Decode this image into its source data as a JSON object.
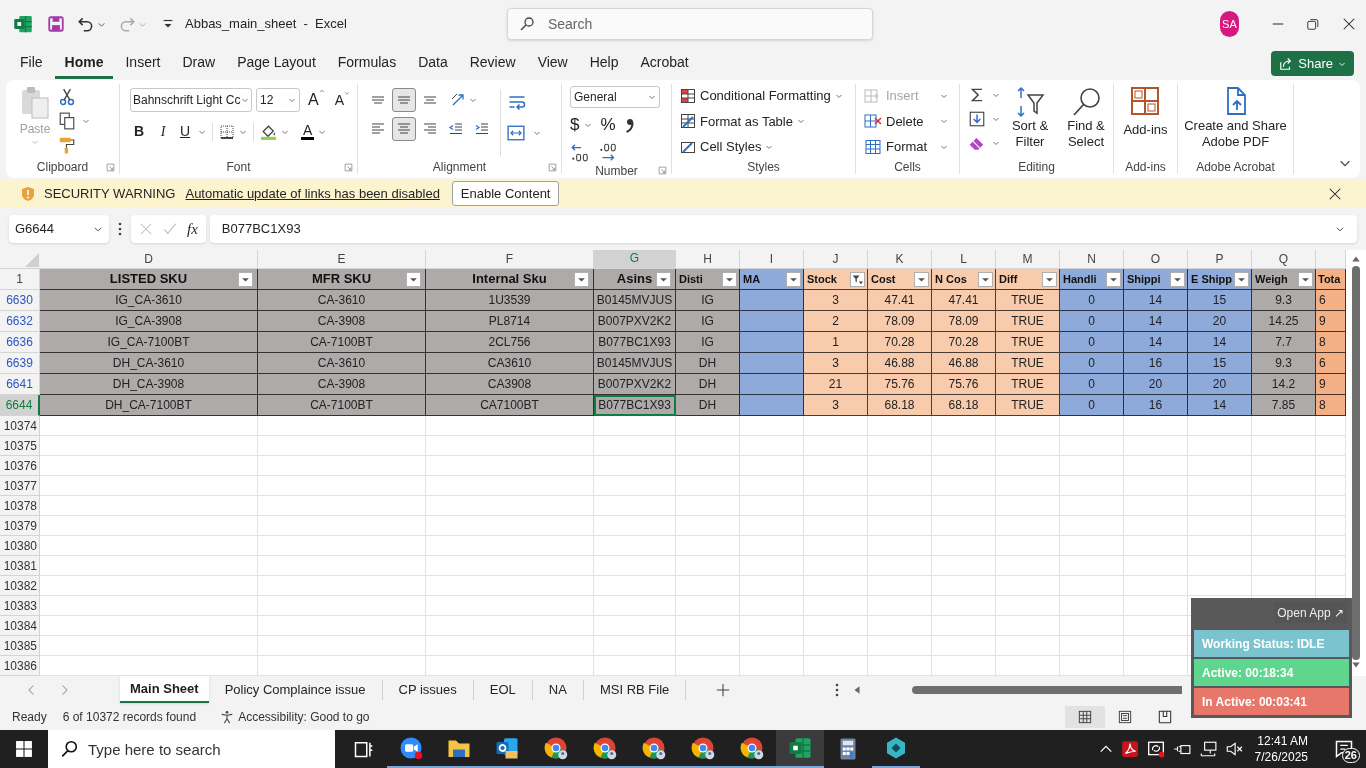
{
  "title_bar": {
    "title": "Abbas_main_sheet  -  Excel",
    "search_placeholder": "Search",
    "account_initials": "SA"
  },
  "ribbon_tabs": [
    {
      "label": "File",
      "selected": false
    },
    {
      "label": "Home",
      "selected": true
    },
    {
      "label": "Insert",
      "selected": false
    },
    {
      "label": "Draw",
      "selected": false
    },
    {
      "label": "Page Layout",
      "selected": false
    },
    {
      "label": "Formulas",
      "selected": false
    },
    {
      "label": "Data",
      "selected": false
    },
    {
      "label": "Review",
      "selected": false
    },
    {
      "label": "View",
      "selected": false
    },
    {
      "label": "Help",
      "selected": false
    },
    {
      "label": "Acrobat",
      "selected": false
    }
  ],
  "share_button": "Share",
  "ribbon": {
    "clipboard": {
      "paste": "Paste",
      "label": "Clipboard"
    },
    "font": {
      "font_name": "Bahnschrift Light Cc",
      "font_size": "12",
      "grow": "A",
      "shrink": "A",
      "bold": "B",
      "italic": "I",
      "underline": "U",
      "font_color": "A",
      "label": "Font"
    },
    "alignment": {
      "vertical": [
        {
          "selected": false
        },
        {
          "selected": true
        },
        {
          "selected": false
        }
      ],
      "horizontal": [
        {
          "selected": false
        },
        {
          "selected": true
        },
        {
          "selected": false
        }
      ],
      "label": "Alignment"
    },
    "number": {
      "format": "General",
      "currency": "$",
      "percent": "%",
      "label": "Number"
    },
    "styles": {
      "conditional_formatting": "Conditional Formatting",
      "format_as_table": "Format as Table",
      "cell_styles": "Cell Styles",
      "label": "Styles"
    },
    "cells": {
      "insert": {
        "label": "Insert",
        "disabled": true
      },
      "delete": {
        "label": "Delete",
        "disabled": false
      },
      "format": {
        "label": "Format",
        "disabled": false
      },
      "label": "Cells"
    },
    "editing": {
      "sort_filter": "Sort & Filter",
      "find_select": "Find & Select",
      "label": "Editing"
    },
    "add_ins": {
      "button": "Add-ins",
      "label": "Add-ins"
    },
    "adobe_acrobat": {
      "button": "Create and Share Adobe PDF",
      "label": "Adobe Acrobat"
    }
  },
  "security_bar": {
    "title": "SECURITY WARNING",
    "message": "Automatic update of links has been disabled",
    "button": "Enable Content"
  },
  "formula_bar": {
    "name_box": "G6644",
    "function_label": "fx",
    "value": "B077BC1X93"
  },
  "sheet": {
    "columns": [
      {
        "letter": "D",
        "header": "LISTED SKU",
        "color": "#aeaaaa",
        "filtered": false,
        "selected": false
      },
      {
        "letter": "E",
        "header": "MFR SKU",
        "color": "#aeaaaa",
        "filtered": false,
        "selected": false
      },
      {
        "letter": "F",
        "header": "Internal Sku",
        "color": "#aeaaaa",
        "filtered": false,
        "selected": false
      },
      {
        "letter": "G",
        "header": "Asins",
        "color": "#aeaaaa",
        "filtered": false,
        "selected": true
      },
      {
        "letter": "H",
        "header": "Disti",
        "color": "#aeaaaa",
        "filtered": false,
        "selected": false
      },
      {
        "letter": "I",
        "header": "MA",
        "color": "#8eaadb",
        "filtered": false,
        "selected": false
      },
      {
        "letter": "J",
        "header": "Stock",
        "color": "#f8cbad",
        "filtered": true,
        "selected": false
      },
      {
        "letter": "K",
        "header": "Cost",
        "color": "#f8cbad",
        "filtered": false,
        "selected": false
      },
      {
        "letter": "L",
        "header": "N Cos",
        "color": "#f8cbad",
        "filtered": false,
        "selected": false
      },
      {
        "letter": "M",
        "header": "Diff",
        "color": "#f8cbad",
        "filtered": false,
        "selected": false
      },
      {
        "letter": "N",
        "header": "Handli",
        "color": "#8eaadb",
        "filtered": false,
        "selected": false
      },
      {
        "letter": "O",
        "header": "Shippi",
        "color": "#8eaadb",
        "filtered": false,
        "selected": false
      },
      {
        "letter": "P",
        "header": "E Shipp",
        "color": "#8eaadb",
        "filtered": false,
        "selected": false
      },
      {
        "letter": "Q",
        "header": "Weigh",
        "color": "#aeaaaa",
        "filtered": false,
        "selected": false
      },
      {
        "header": "Tota",
        "color": "#f4b084",
        "selected": false
      }
    ],
    "header_row_number": "1",
    "rows": [
      {
        "number": "6630",
        "selected": false,
        "cells": [
          "IG_CA-3610",
          "CA-3610",
          "1U3539",
          "B0145MVJUS",
          "IG",
          "",
          "3",
          "47.41",
          "47.41",
          "TRUE",
          "0",
          "14",
          "15",
          "9.3",
          "6"
        ]
      },
      {
        "number": "6632",
        "selected": false,
        "cells": [
          "IG_CA-3908",
          "CA-3908",
          "PL8714",
          "B007PXV2K2",
          "IG",
          "",
          "2",
          "78.09",
          "78.09",
          "TRUE",
          "0",
          "14",
          "20",
          "14.25",
          "9"
        ]
      },
      {
        "number": "6636",
        "selected": false,
        "cells": [
          "IG_CA-7100BT",
          "CA-7100BT",
          "2CL756",
          "B077BC1X93",
          "IG",
          "",
          "1",
          "70.28",
          "70.28",
          "TRUE",
          "0",
          "14",
          "14",
          "7.7",
          "8"
        ]
      },
      {
        "number": "6639",
        "selected": false,
        "cells": [
          "DH_CA-3610",
          "CA-3610",
          "CA3610",
          "B0145MVJUS",
          "DH",
          "",
          "3",
          "46.88",
          "46.88",
          "TRUE",
          "0",
          "16",
          "15",
          "9.3",
          "6"
        ]
      },
      {
        "number": "6641",
        "selected": false,
        "cells": [
          "DH_CA-3908",
          "CA-3908",
          "CA3908",
          "B007PXV2K2",
          "DH",
          "",
          "21",
          "75.76",
          "75.76",
          "TRUE",
          "0",
          "20",
          "20",
          "14.2",
          "9"
        ]
      },
      {
        "number": "6644",
        "selected": true,
        "cells": [
          "DH_CA-7100BT",
          "CA-7100BT",
          "CA7100BT",
          "B077BC1X93",
          "DH",
          "",
          "3",
          "68.18",
          "68.18",
          "TRUE",
          "0",
          "16",
          "14",
          "7.85",
          "8"
        ]
      }
    ],
    "empty_rows": [
      "10374",
      "10375",
      "10376",
      "10377",
      "10378",
      "10379",
      "10380",
      "10381",
      "10382",
      "10383",
      "10384",
      "10385",
      "10386"
    ]
  },
  "sheet_tabs": [
    {
      "label": "Main Sheet",
      "selected": true
    },
    {
      "label": "Policy Complaince issue",
      "selected": false
    },
    {
      "label": "CP issues",
      "selected": false
    },
    {
      "label": "EOL",
      "selected": false
    },
    {
      "label": "NA",
      "selected": false
    },
    {
      "label": "MSI RB File",
      "selected": false
    }
  ],
  "status_bar": {
    "mode": "Ready",
    "records": "6 of 10372 records found",
    "accessibility": "Accessibility: Good to go"
  },
  "tracker_widget": {
    "open_app": "Open App ↗",
    "working_status": "Working Status: IDLE",
    "active": "Active: 00:18:34",
    "inactive": "In Active: 00:03:41"
  },
  "taskbar": {
    "search_placeholder": "Type here to search",
    "time": "12:41 AM",
    "date": "7/26/2025",
    "notification_count": "26"
  }
}
